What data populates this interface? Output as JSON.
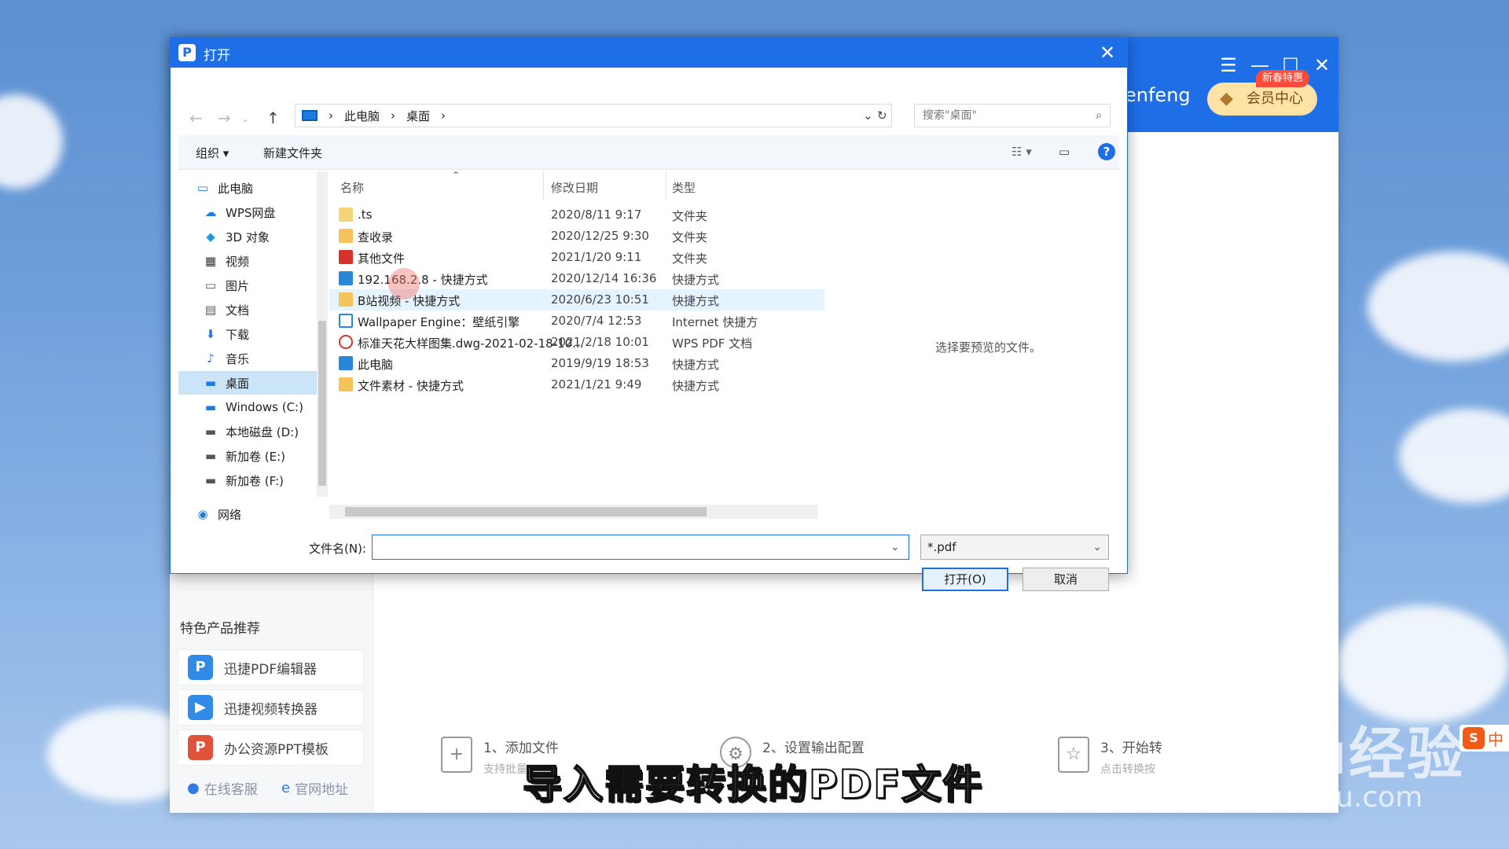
{
  "dialog": {
    "title": "打开",
    "address": [
      "此电脑",
      "桌面"
    ],
    "search_placeholder": "搜索\"桌面\"",
    "toolbar": {
      "organize": "组织 ▾",
      "new_folder": "新建文件夹"
    },
    "columns": {
      "name": "名称",
      "modified": "修改日期",
      "type": "类型"
    },
    "tree": [
      {
        "label": "此电脑",
        "icon": "computer-icon"
      },
      {
        "label": "WPS网盘",
        "icon": "cloud-icon"
      },
      {
        "label": "3D 对象",
        "icon": "cube-icon"
      },
      {
        "label": "视频",
        "icon": "video-icon"
      },
      {
        "label": "图片",
        "icon": "picture-icon"
      },
      {
        "label": "文档",
        "icon": "document-icon"
      },
      {
        "label": "下载",
        "icon": "download-icon"
      },
      {
        "label": "音乐",
        "icon": "music-icon"
      },
      {
        "label": "桌面",
        "icon": "desktop-icon",
        "selected": true
      },
      {
        "label": "Windows (C:)",
        "icon": "drive-icon"
      },
      {
        "label": "本地磁盘 (D:)",
        "icon": "drive-icon"
      },
      {
        "label": "新加卷 (E:)",
        "icon": "drive-icon"
      },
      {
        "label": "新加卷 (F:)",
        "icon": "drive-icon"
      },
      {
        "label": "网络",
        "icon": "network-icon"
      }
    ],
    "files": [
      {
        "name": ".ts",
        "modified": "2020/8/11 9:17",
        "type": "文件夹",
        "icon": "folder-icon"
      },
      {
        "name": "查收录",
        "modified": "2020/12/25 9:30",
        "type": "文件夹",
        "icon": "folder-icon"
      },
      {
        "name": "其他文件",
        "modified": "2021/1/20 9:11",
        "type": "文件夹",
        "icon": "red-folder-icon"
      },
      {
        "name": "192.168.2.8 - 快捷方式",
        "modified": "2020/12/14 16:36",
        "type": "快捷方式",
        "icon": "computer-shortcut-icon"
      },
      {
        "name": "B站视频 - 快捷方式",
        "modified": "2020/6/23 10:51",
        "type": "快捷方式",
        "icon": "folder-shortcut-icon",
        "hover": true
      },
      {
        "name": "Wallpaper Engine：壁纸引擎",
        "modified": "2020/7/4 12:53",
        "type": "Internet 快捷方",
        "icon": "internet-shortcut-icon"
      },
      {
        "name": "标准天花大样图集.dwg-2021-02-18-10...",
        "modified": "2021/2/18 10:01",
        "type": "WPS PDF 文档",
        "icon": "pdf-icon"
      },
      {
        "name": "此电脑",
        "modified": "2019/9/19 18:53",
        "type": "快捷方式",
        "icon": "computer-shortcut-icon"
      },
      {
        "name": "文件素材 - 快捷方式",
        "modified": "2021/1/21 9:49",
        "type": "快捷方式",
        "icon": "folder-shortcut-icon"
      }
    ],
    "preview_text": "选择要预览的文件。",
    "filename_label": "文件名(N):",
    "filename_value": "",
    "filetype_value": "*.pdf",
    "open_label": "打开(O)",
    "cancel_label": "取消"
  },
  "app": {
    "user_name": "enfeng",
    "vip_label": "会员中心",
    "vip_badge": "新春特惠",
    "featured_title": "特色产品推荐",
    "products": [
      {
        "label": "迅捷PDF编辑器",
        "icon_text": "P",
        "color": "#2f8be6"
      },
      {
        "label": "迅捷视频转换器",
        "icon_text": "▶",
        "color": "#2f8be6"
      },
      {
        "label": "办公资源PPT模板",
        "icon_text": "P",
        "color": "#e0533a"
      }
    ],
    "footer": {
      "service": "在线客服",
      "website": "官网地址"
    },
    "steps": [
      {
        "title": "1、添加文件",
        "sub": "支持批量"
      },
      {
        "title": "2、设置输出配置",
        "sub": ""
      },
      {
        "title": "3、开始转",
        "sub": "点击转换按"
      }
    ]
  },
  "overlay": {
    "subtitle": "导入需要转换的PDF文件",
    "watermark_brand": "Baidu经验",
    "watermark_url": "jingyan.baidu.com",
    "ime_label": "中"
  }
}
